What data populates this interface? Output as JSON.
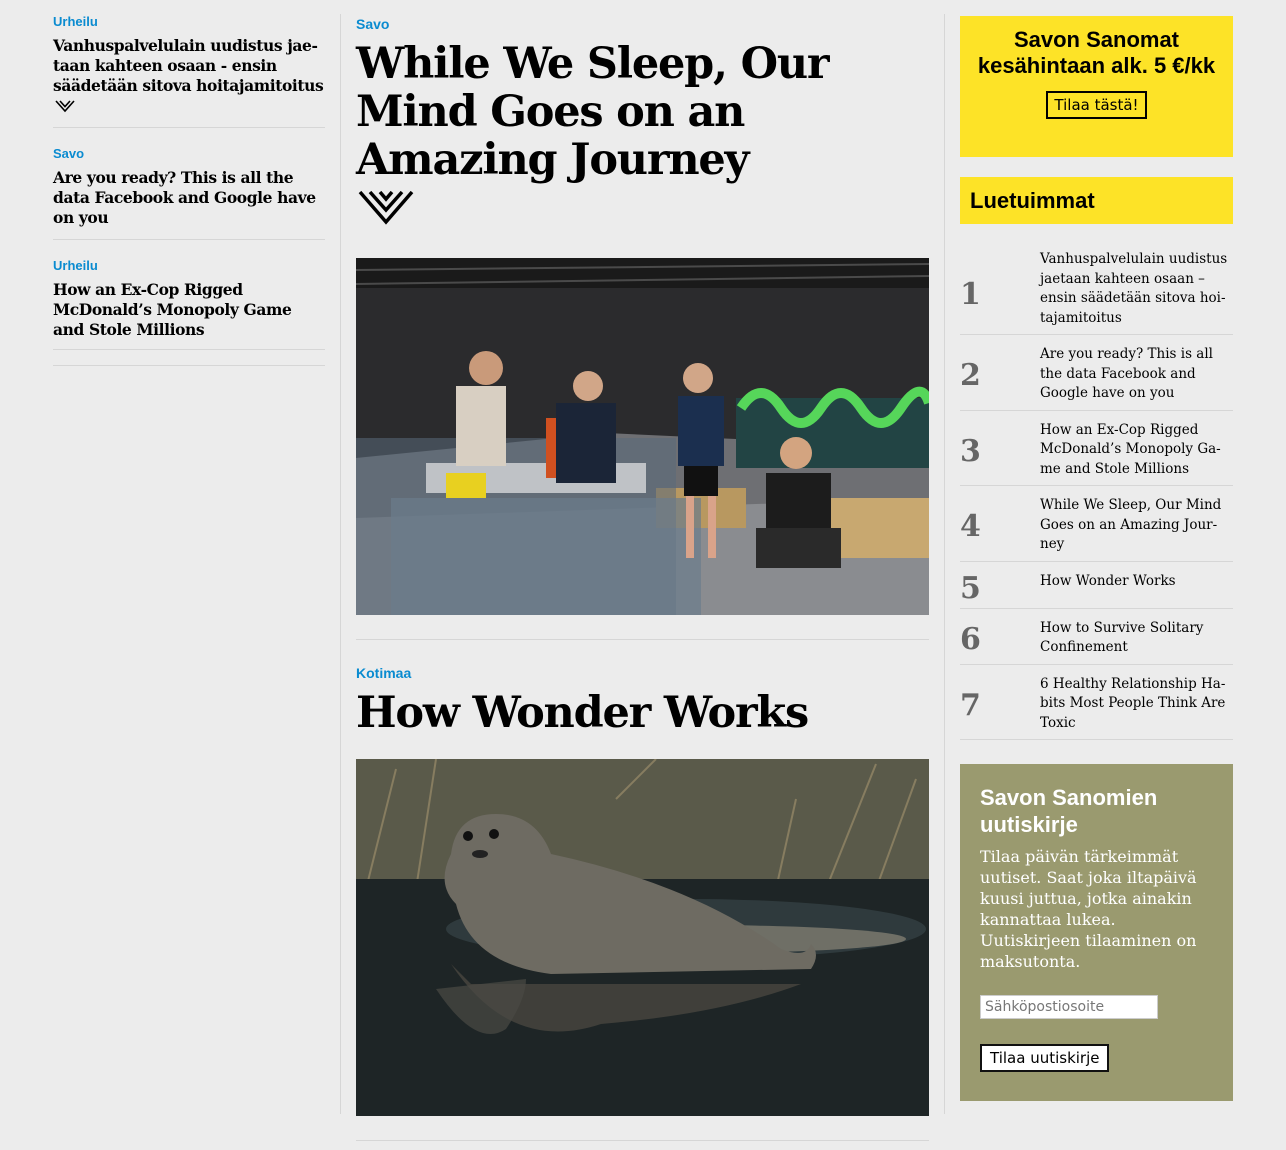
{
  "left_column": {
    "items": [
      {
        "category": "Urheilu",
        "title": "Vanhuspalvelulain uudistus jae­taan kahteen osaan - ensin sääde­tään sitova hoitajamitoitus",
        "premium": true
      },
      {
        "category": "Savo",
        "title": "Are you ready? This is all the data Facebook and Google have on you",
        "premium": false
      },
      {
        "category": "Urheilu",
        "title": "How an Ex-Cop Rigged McDonald’s Monopoly Game and Stole Millions",
        "premium": false
      }
    ]
  },
  "main_column": {
    "articles": [
      {
        "category": "Savo",
        "title": "While We Sleep, Our Mind Goes on an Amazing Journey",
        "premium": true,
        "image": "workers-in-hall-photo"
      },
      {
        "category": "Kotimaa",
        "title": "How Wonder Works",
        "premium": false,
        "image": "seal-on-rock-photo"
      }
    ]
  },
  "promo": {
    "title_line1": "Savon Sanomat",
    "title_line2": "kesähintaan alk. 5 €/kk",
    "button": "Tilaa tästä!"
  },
  "popular": {
    "heading": "Luetuimmat",
    "items": [
      {
        "num": "1",
        "title": "Vanhuspalvelulain uudistus jaetaan kahteen osaan – ensin säädetään sitova hoi­tajamitoitus"
      },
      {
        "num": "2",
        "title": "Are you ready? This is all the data Facebook and Google have on you"
      },
      {
        "num": "3",
        "title": "How an Ex-Cop Rigged McDonald’s Monopoly Ga­me and Stole Millions"
      },
      {
        "num": "4",
        "title": "While We Sleep, Our Mind Goes on an Amazing Jour­ney"
      },
      {
        "num": "5",
        "title": "How Wonder Works"
      },
      {
        "num": "6",
        "title": "How to Survive Solitary Confinement"
      },
      {
        "num": "7",
        "title": "6 Healthy Relationship Ha­bits Most People Think Are Toxic"
      }
    ]
  },
  "newsletter": {
    "title": "Savon Sanomien uutiskirje",
    "text": "Tilaa päivän tärkeimmät uutiset. Saat joka iltapäivä kuusi juttua, jotka ainakin kannattaa lukea. Uutiskirjeen tilaaminen on maksutonta.",
    "input_placeholder": "Sähköpostiosoite",
    "button": "Tilaa uutiskirje"
  },
  "colors": {
    "category": "#0a8bd0",
    "promo_bg": "#fde327",
    "newsletter_bg": "#9a9a6f"
  }
}
